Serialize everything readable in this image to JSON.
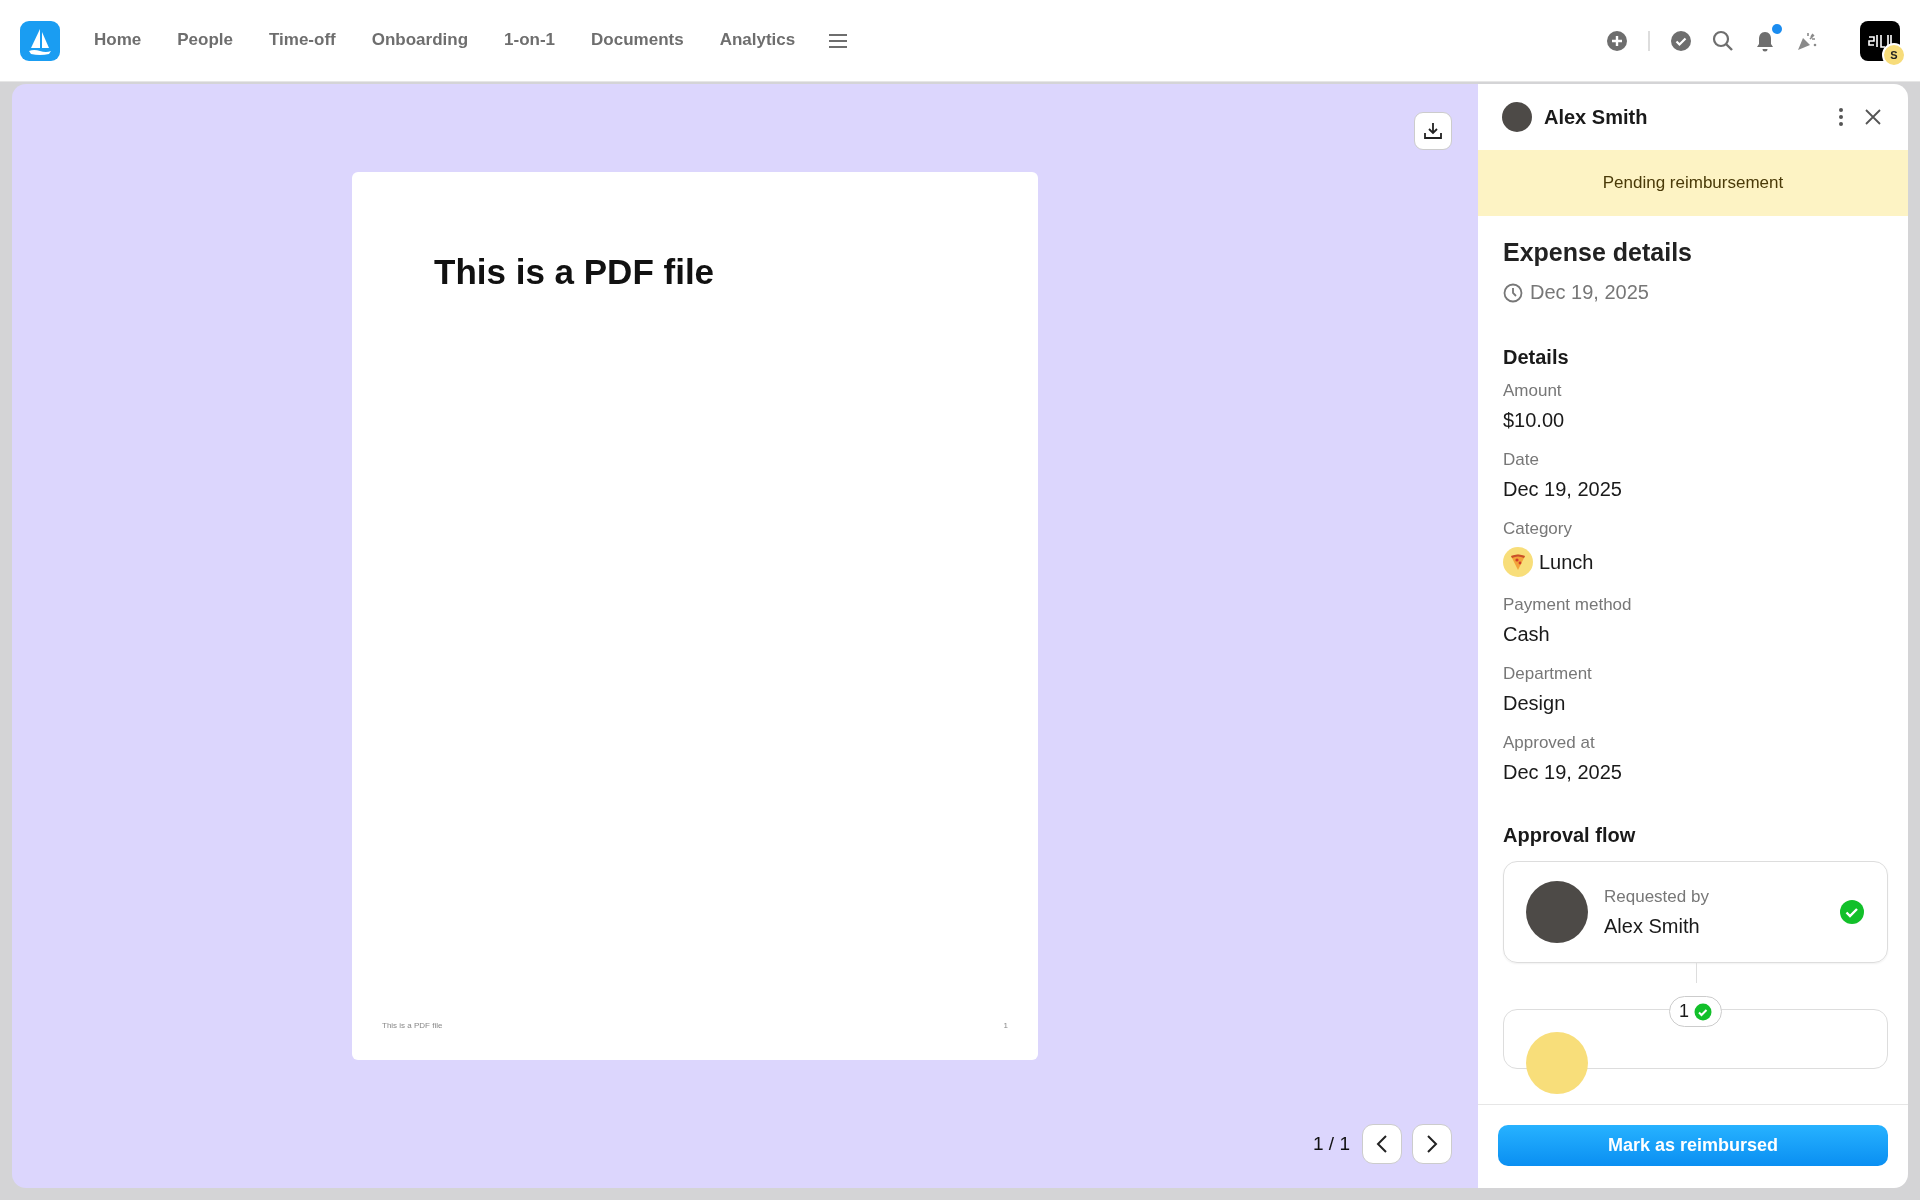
{
  "nav": {
    "items": [
      {
        "label": "Home"
      },
      {
        "label": "People"
      },
      {
        "label": "Time-off"
      },
      {
        "label": "Onboarding"
      },
      {
        "label": "1-on-1"
      },
      {
        "label": "Documents"
      },
      {
        "label": "Analytics"
      }
    ],
    "bell_unread": true,
    "user_badge": "S"
  },
  "viewer": {
    "document_title": "This is a PDF file",
    "footer_text": "This is a PDF file",
    "page_number": "1",
    "pagination": "1 / 1"
  },
  "panel": {
    "person": "Alex Smith",
    "status": "Pending reimbursement",
    "heading": "Expense details",
    "date": "Dec 19, 2025",
    "section": "Details",
    "fields": [
      {
        "label": "Amount",
        "value": "$10.00",
        "kind": "text"
      },
      {
        "label": "Date",
        "value": "Dec 19, 2025",
        "kind": "text"
      },
      {
        "label": "Category",
        "value": "Lunch",
        "kind": "category"
      },
      {
        "label": "Payment method",
        "value": "Cash",
        "kind": "text"
      },
      {
        "label": "Department",
        "value": "Design",
        "kind": "text"
      },
      {
        "label": "Approved at",
        "value": "Dec 19, 2025",
        "kind": "text"
      }
    ],
    "approval_title": "Approval flow",
    "approval_steps": [
      {
        "caption": "Requested by",
        "name": "Alex Smith",
        "done": true
      }
    ],
    "step_count": "1",
    "step_count_done": true,
    "action": "Mark as reimbursed"
  }
}
